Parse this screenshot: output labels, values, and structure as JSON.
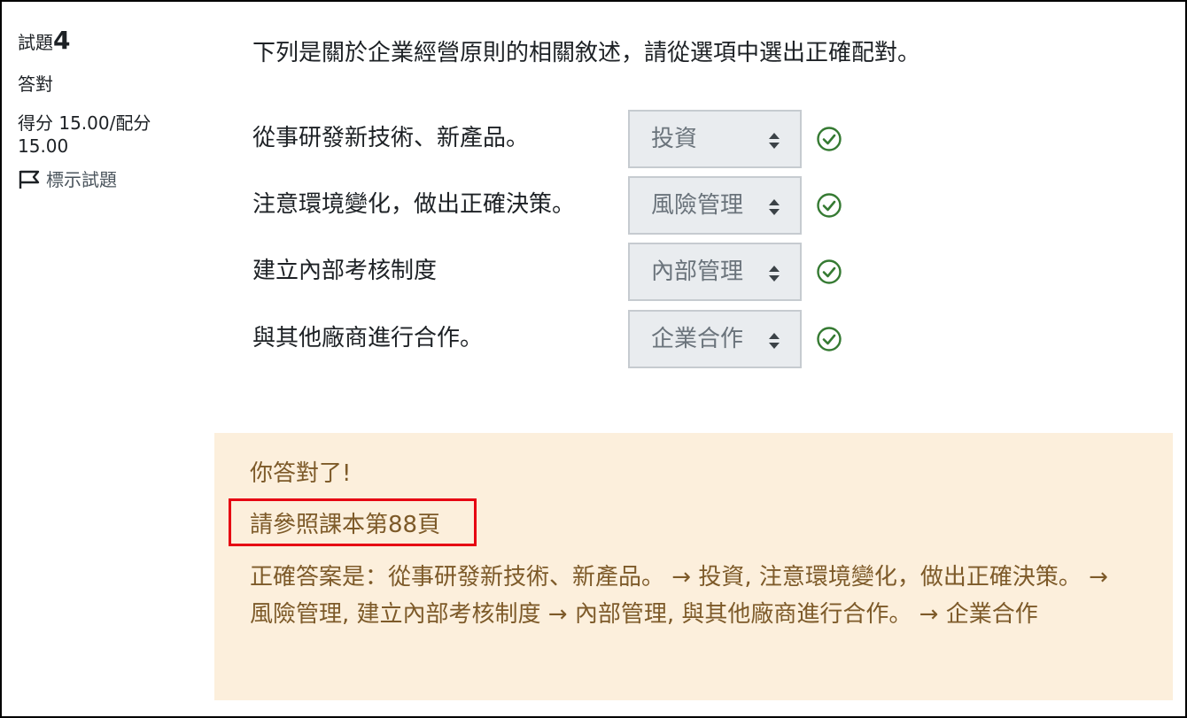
{
  "question": {
    "label": "試題",
    "number": "4",
    "state": "答對",
    "grade": "得分 15.00/配分 15.00",
    "flag_label": "標示試題"
  },
  "prompt": "下列是關於企業經營原則的相關敘述，請從選項中選出正確配對。",
  "rows": [
    {
      "stem": "從事研發新技術、新產品。",
      "selected": "投資"
    },
    {
      "stem": "注意環境變化，做出正確決策。",
      "selected": "風險管理"
    },
    {
      "stem": "建立內部考核制度",
      "selected": "內部管理"
    },
    {
      "stem": "與其他廠商進行合作。",
      "selected": "企業合作"
    }
  ],
  "feedback": {
    "result": "你答對了!",
    "hint": "請參照課本第88頁",
    "right_answer": "正確答案是：從事研發新技術、新產品。 → 投資, 注意環境變化，做出正確決策。 → 風險管理, 建立內部考核制度 → 內部管理, 與其他廠商進行合作。 → 企業合作"
  },
  "colors": {
    "correct_green": "#357a32",
    "feedback_bg": "#fcefdc",
    "feedback_text": "#7d5a29",
    "highlight_red": "#e60012"
  },
  "icons": {
    "flag": "flag-icon",
    "select_arrows": "sort-arrows-icon",
    "correct": "check-circle-icon"
  }
}
